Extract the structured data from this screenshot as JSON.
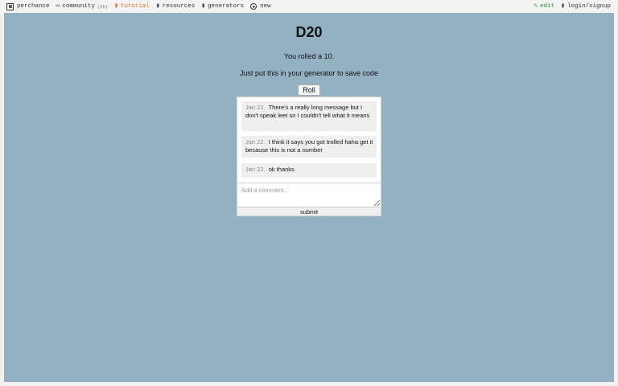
{
  "nav": {
    "brand": "perchance",
    "community": "community",
    "community_badge": "(2h)",
    "tutorial": "tutorial",
    "resources": "resources",
    "generators": "generators",
    "new": "new",
    "edit": "edit",
    "login": "login/signup"
  },
  "icons": {
    "brand": "dice-icon",
    "community": "chat-icon",
    "tutorial": "book-icon",
    "resources": "link-icon",
    "generators": "grid-icon",
    "new": "plus-circle-icon",
    "edit": "pencil-icon",
    "login": "user-icon"
  },
  "colors": {
    "panel": "#93b1c3",
    "tutorial": "#e0701f",
    "edit": "#2a8f2a"
  },
  "page": {
    "title": "D20",
    "result": "You rolled a 10.",
    "hint": "Just put this in your generator to save code",
    "roll_label": "Roll"
  },
  "comments": {
    "items": [
      {
        "date": "Jan 22.",
        "text": "There's a really long message but I don't speak leet so I couldn't tell what it means"
      },
      {
        "date": "Jan 22.",
        "text": "I think it says you got trolled haha get it because this is not a number"
      },
      {
        "date": "Jan 22.",
        "text": "ok thanks"
      }
    ],
    "placeholder": "Add a comment...",
    "submit_label": "submit"
  }
}
